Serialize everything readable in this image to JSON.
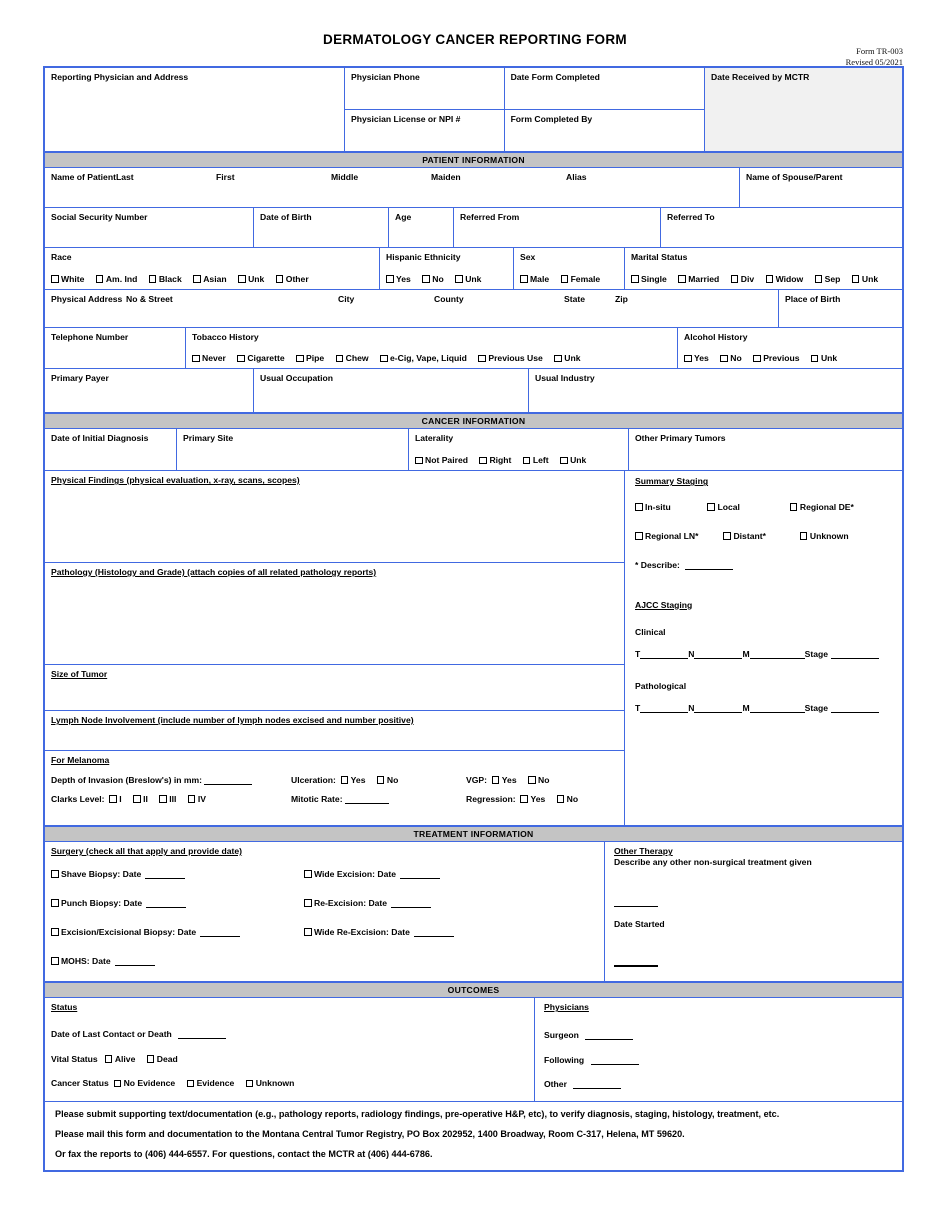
{
  "title": "DERMATOLOGY CANCER REPORTING FORM",
  "form_number": "Form TR-003",
  "revised": "Revised 05/2021",
  "header": {
    "reporting_physician": "Reporting Physician and Address",
    "physician_phone": "Physician Phone",
    "date_form_completed": "Date Form Completed",
    "physician_license": "Physician License or NPI #",
    "form_completed_by": "Form Completed By",
    "date_received": "Date Received by MCTR"
  },
  "sections": {
    "patient": "PATIENT INFORMATION",
    "cancer": "CANCER INFORMATION",
    "treatment": "TREATMENT INFORMATION",
    "outcomes": "OUTCOMES"
  },
  "patient": {
    "name_of_patient": "Name of Patient",
    "last": "Last",
    "first": "First",
    "middle": "Middle",
    "maiden": "Maiden",
    "alias": "Alias",
    "spouse_parent": "Name of Spouse/Parent",
    "ssn": "Social Security Number",
    "dob": "Date of Birth",
    "age": "Age",
    "referred_from": "Referred From",
    "referred_to": "Referred To",
    "race_label": "Race",
    "race_options": [
      "White",
      "Am. Ind",
      "Black",
      "Asian",
      "Unk",
      "Other"
    ],
    "hispanic_label": "Hispanic Ethnicity",
    "hispanic_options": [
      "Yes",
      "No",
      "Unk"
    ],
    "sex_label": "Sex",
    "sex_options": [
      "Male",
      "Female"
    ],
    "marital_label": "Marital Status",
    "marital_options": [
      "Single",
      "Married",
      "Div",
      "Widow",
      "Sep",
      "Unk"
    ],
    "physical_address": "Physical Address",
    "no_street": "No & Street",
    "city": "City",
    "county": "County",
    "state": "State",
    "zip": "Zip",
    "place_of_birth": "Place of Birth",
    "telephone": "Telephone Number",
    "tobacco_label": "Tobacco History",
    "tobacco_options": [
      "Never",
      "Cigarette",
      "Pipe",
      "Chew",
      "e-Cig, Vape, Liquid",
      "Previous Use",
      "Unk"
    ],
    "alcohol_label": "Alcohol History",
    "alcohol_options": [
      "Yes",
      "No",
      "Previous",
      "Unk"
    ],
    "primary_payer": "Primary Payer",
    "usual_occupation": "Usual Occupation",
    "usual_industry": "Usual Industry"
  },
  "cancer": {
    "date_initial_diagnosis": "Date of Initial Diagnosis",
    "primary_site": "Primary Site",
    "laterality_label": "Laterality",
    "laterality_options": [
      "Not Paired",
      "Right",
      "Left",
      "Unk"
    ],
    "other_primary_tumors": "Other Primary Tumors",
    "physical_findings": "Physical Findings (physical evaluation, x-ray, scans, scopes)",
    "pathology": "Pathology (Histology and Grade) (attach copies of all related pathology reports)",
    "size_of_tumor": "Size of Tumor",
    "lymph_node": "Lymph Node Involvement (include number of lymph nodes excised and number positive)",
    "summary_staging_label": "Summary Staging",
    "summary_staging_row1": [
      "In-situ",
      "Local",
      "Regional DE*"
    ],
    "summary_staging_row2": [
      "Regional LN*",
      "Distant*",
      "Unknown"
    ],
    "describe": "* Describe:",
    "ajcc_label": "AJCC Staging",
    "clinical": "Clinical",
    "pathological": "Pathological",
    "t": "T",
    "n": "N",
    "m": "M",
    "stage": "Stage"
  },
  "melanoma": {
    "heading": "For Melanoma",
    "depth_label": "Depth of Invasion (Breslow's) in mm:",
    "ulceration_label": "Ulceration:",
    "ulceration_options": [
      "Yes",
      "No"
    ],
    "vgp_label": "VGP:",
    "vgp_options": [
      "Yes",
      "No"
    ],
    "clarks_label": "Clarks Level:",
    "clarks_options": [
      "I",
      "II",
      "III",
      "IV"
    ],
    "mitotic_label": "Mitotic Rate:",
    "regression_label": "Regression:",
    "regression_options": [
      "Yes",
      "No"
    ]
  },
  "treatment": {
    "surgery_heading": "Surgery (check all that apply and provide date)",
    "surgery_col1": [
      "Shave Biopsy: Date",
      "Punch Biopsy: Date",
      "Excision/Excisional Biopsy: Date",
      "MOHS: Date"
    ],
    "surgery_col2": [
      "Wide Excision: Date",
      "Re-Excision: Date",
      "Wide Re-Excision: Date"
    ],
    "other_therapy_heading": "Other Therapy",
    "other_therapy_desc": "Describe any other non-surgical treatment given",
    "date_started": "Date Started"
  },
  "outcomes": {
    "status_heading": "Status",
    "date_last_contact": "Date of Last Contact or Death",
    "vital_status_label": "Vital Status",
    "vital_status_options": [
      "Alive",
      "Dead"
    ],
    "cancer_status_label": "Cancer Status",
    "cancer_status_options": [
      "No Evidence",
      "Evidence",
      "Unknown"
    ],
    "physicians_heading": "Physicians",
    "surgeon": "Surgeon",
    "following": "Following",
    "other": "Other"
  },
  "footer": {
    "line1": "Please submit supporting text/documentation (e.g., pathology reports, radiology findings, pre-operative H&P, etc), to verify diagnosis, staging, histology, treatment, etc.",
    "line2": "Please mail this form and documentation to the Montana Central Tumor Registry, PO Box 202952, 1400 Broadway, Room C-317, Helena, MT  59620.",
    "line3": "Or fax the reports to (406) 444-6557.  For questions, contact the MCTR at (406) 444-6786."
  },
  "colors": {
    "border": "#4169e1",
    "section_bar": "#c4c4c4",
    "shaded_cell": "#f1f1f1"
  }
}
